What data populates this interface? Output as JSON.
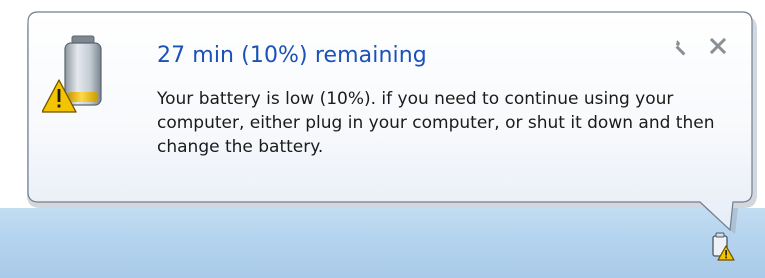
{
  "notification": {
    "title": "27 min (10%) remaining",
    "message": "Your battery is low (10%). if you need to continue using your computer, either plug in your computer, or shut it down and then change the battery.",
    "icon": "battery-low-warning-icon",
    "actions": {
      "options_icon": "wrench-icon",
      "close_icon": "close-icon"
    }
  },
  "taskbar": {
    "tray_icon": "battery-warning-tray-icon"
  },
  "battery": {
    "charge_level": 0.1
  },
  "colors": {
    "title": "#1a52b8",
    "taskbar": "#b4d3ee",
    "warning": "#f5c400"
  }
}
